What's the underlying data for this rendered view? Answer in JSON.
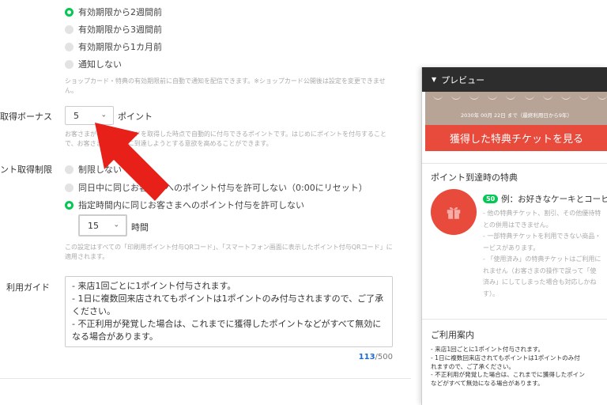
{
  "notify_options": [
    {
      "label": "有効期限から2週間前",
      "checked": true
    },
    {
      "label": "有効期限から3週間前",
      "checked": false
    },
    {
      "label": "有効期限から1カ月前",
      "checked": false
    },
    {
      "label": "通知しない",
      "checked": false
    }
  ],
  "notify_hint": "ショップカード・特典の有効期限前に自動で通知を配信できます。※ショップカード公開後は設定を変更できません。",
  "bonus": {
    "label": "取得ボーナス",
    "value": "5",
    "unit": "ポイント",
    "hint": "お客さまがショップカードを取得した時点で自動的に付与できるポイントです。はじめにポイントを付与することで、お客さまがゴールに到達しようとする意欲を高めることができます。"
  },
  "limit": {
    "label": "ント取得制限",
    "options": [
      {
        "label": "制限しない",
        "checked": false
      },
      {
        "label": "同日中に同じお客さまへのポイント付与を許可しない（0:00にリセット）",
        "checked": false
      },
      {
        "label": "指定時間内に同じお客さまへのポイント付与を許可しない",
        "checked": true
      }
    ],
    "hours_value": "15",
    "hours_unit": "時間",
    "hint": "この設定はすべての「印刷用ポイント付与QRコード」、「スマートフォン画面に表示したポイント付与QRコード」に適用されます。"
  },
  "guide": {
    "label": "利用ガイド",
    "lines": [
      "- 来店1回ごとに1ポイント付与されます。",
      "- 1日に複数回来店されてもポイントは1ポイントのみ付与されますので、ご了承ください。",
      "- 不正利用が発覚した場合は、これまでに獲得したポイントなどがすべて無効になる場合があります。"
    ],
    "count_current": "113",
    "count_max": "/500"
  },
  "preview": {
    "header": "プレビュー",
    "ticket_date": "2030年 00月 22日 まで（最終利用日から9年）",
    "see_button": "獲得した特典チケットを見る",
    "benefit_title": "ポイント到達時の特典",
    "benefit_points": "50",
    "benefit_name": "例：お好きなケーキとコーヒ",
    "benefit_notes": [
      "- 他の特典チケット、割引、その他優待特",
      "との併用はできません。",
      "- 一部特典チケットを利用できない商品・",
      "ービスがあります。",
      "- 「使用済み」の特典チケットはご利用に",
      "れません（お客さまの操作で誤って「使",
      "済み」にしてしまった場合も対応しかね",
      "す）。"
    ],
    "guide_title": "ご利用案内",
    "guide_lines": [
      "- 来店1回ごとに1ポイント付与されます。",
      "- 1日に複数回来店されてもポイントは1ポイントのみ付",
      "れますので、ご了承ください。",
      "- 不正利用が発覚した場合は、これまでに獲得したポイン",
      "などがすべて無効になる場合があります。"
    ]
  },
  "colors": {
    "accent_green": "#06c755",
    "arrow_red": "#e8201a",
    "button_red": "#e84a3c",
    "count_blue": "#1e6ad6"
  },
  "icons": [
    "chevron-down-icon",
    "gift-icon",
    "caret-down-icon",
    "arrow-pointer-icon"
  ]
}
